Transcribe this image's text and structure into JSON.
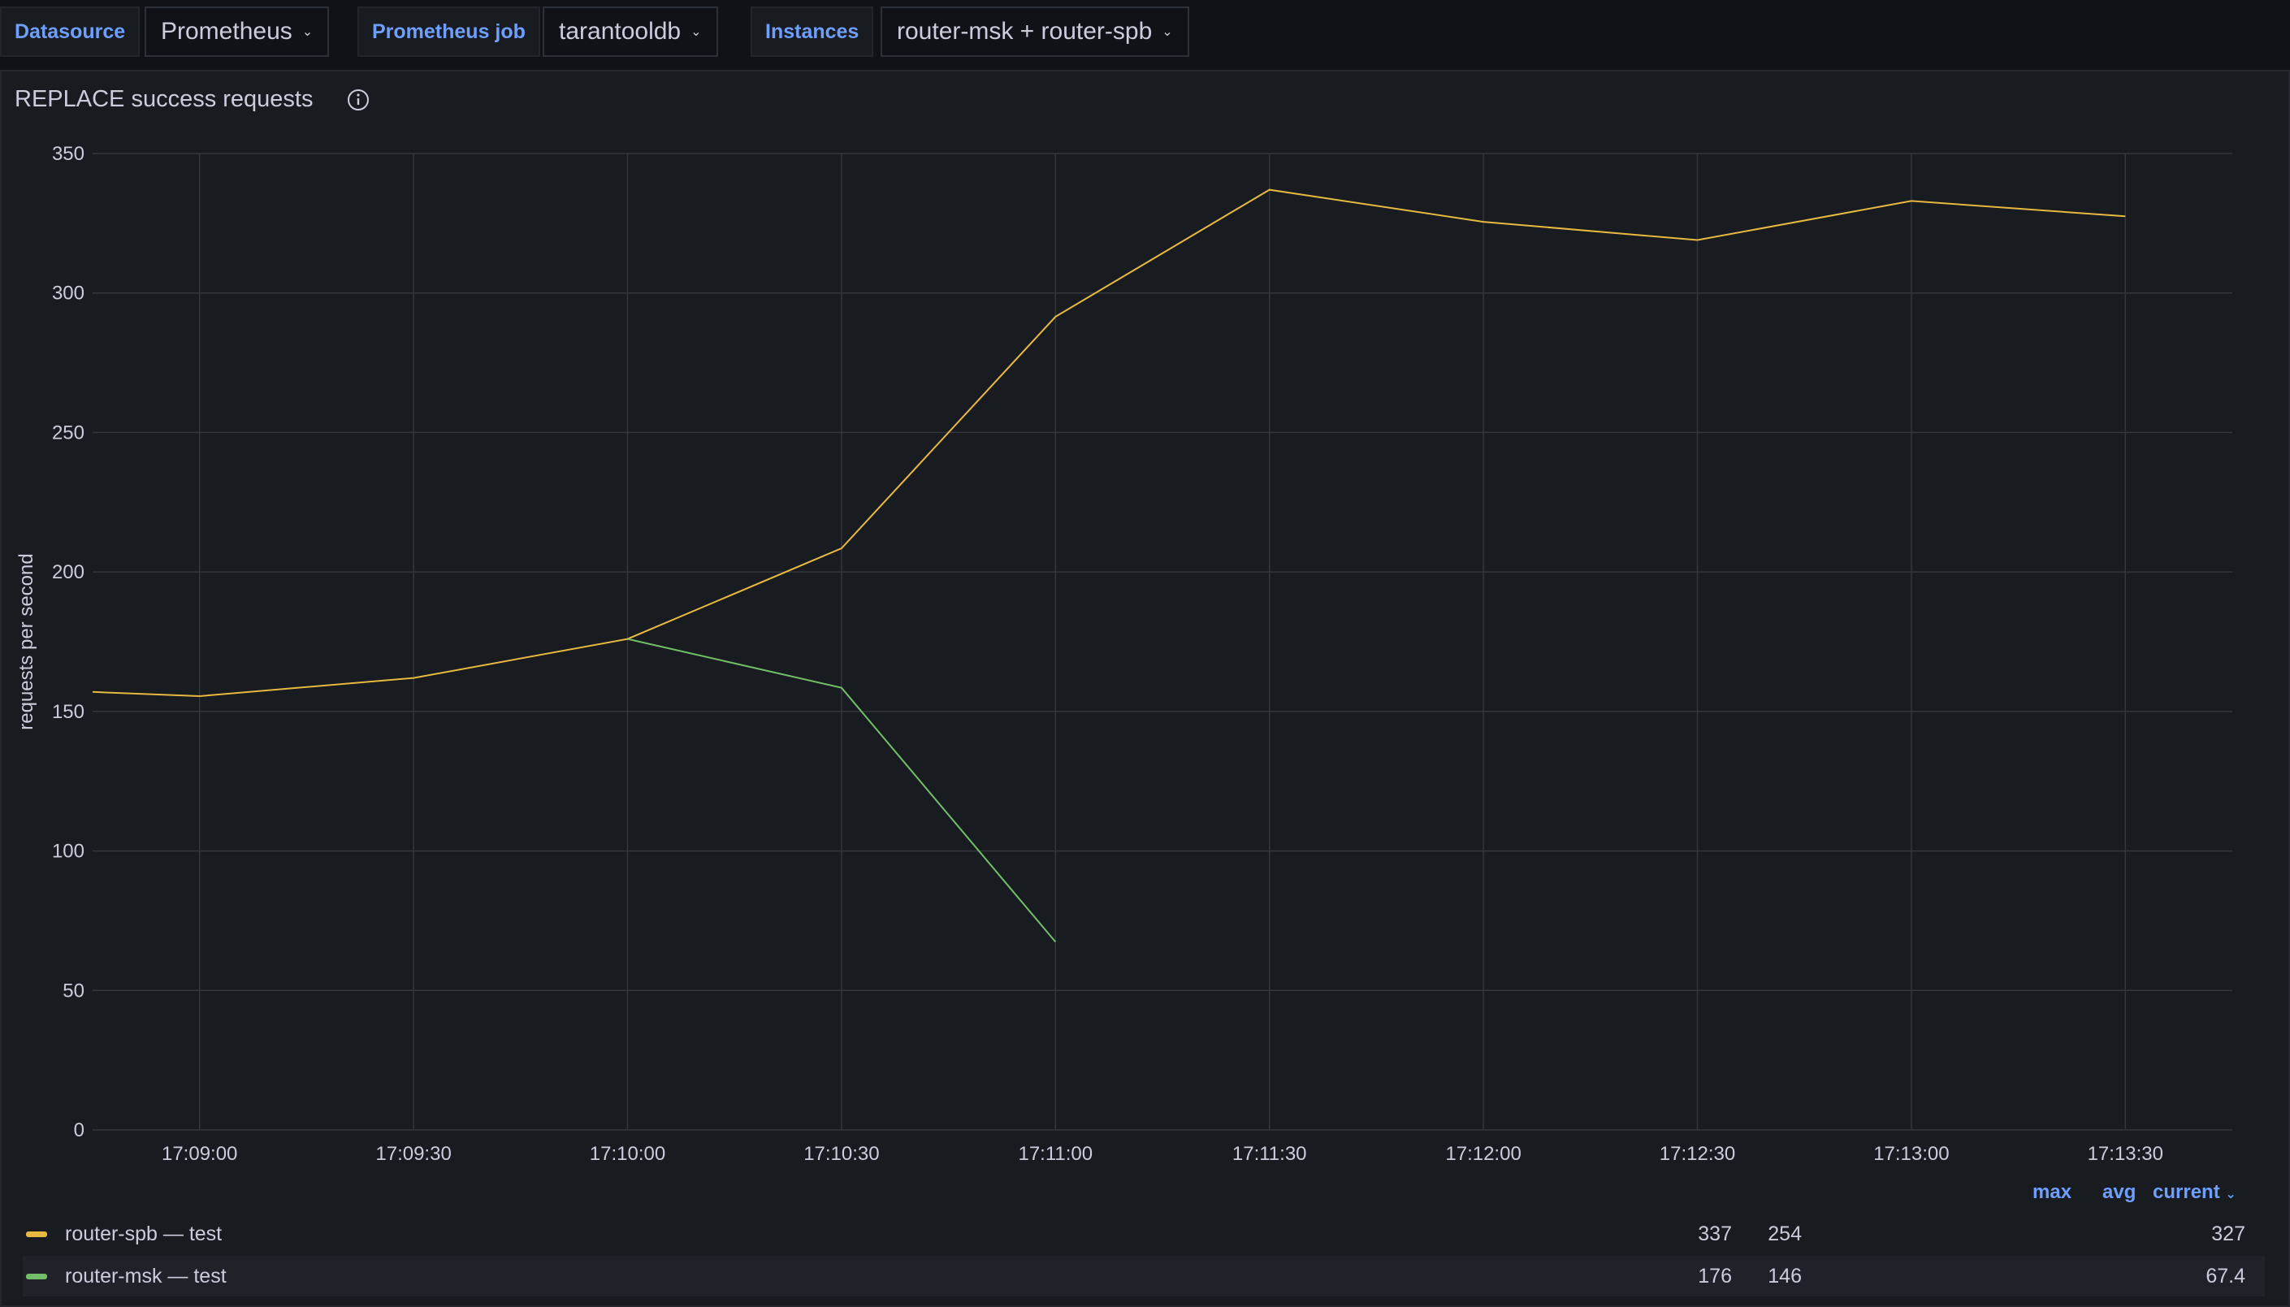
{
  "variables": {
    "datasource": {
      "label": "Datasource",
      "value": "Prometheus"
    },
    "job": {
      "label": "Prometheus job",
      "value": "tarantooldb"
    },
    "instances": {
      "label": "Instances",
      "value": "router-msk + router-spb"
    }
  },
  "panel": {
    "title": "REPLACE success requests"
  },
  "legend": {
    "headers": {
      "max": "max",
      "avg": "avg",
      "current": "current"
    },
    "rows": [
      {
        "name": "router-spb — test",
        "max": "337",
        "avg": "254",
        "current": "327"
      },
      {
        "name": "router-msk — test",
        "max": "176",
        "avg": "146",
        "current": "67.4"
      }
    ]
  },
  "colors": {
    "router-spb": "#e8b940",
    "router-msk": "#73bf69",
    "accent": "#6e9fff"
  },
  "icons": {
    "info": "info-circle-icon",
    "chevron": "chevron-down-icon"
  },
  "chart_data": {
    "type": "line",
    "title": "REPLACE success requests",
    "ylabel": "requests per second",
    "xlabel": "",
    "ylim": [
      0,
      350
    ],
    "yticks": [
      0,
      50,
      100,
      150,
      200,
      250,
      300,
      350
    ],
    "xticks": [
      "17:09:00",
      "17:09:30",
      "17:10:00",
      "17:10:30",
      "17:11:00",
      "17:11:30",
      "17:12:00",
      "17:12:30",
      "17:13:00",
      "17:13:30"
    ],
    "x": [
      "17:08:45",
      "17:09:00",
      "17:09:30",
      "17:10:00",
      "17:10:30",
      "17:11:00",
      "17:11:30",
      "17:12:00",
      "17:12:30",
      "17:13:00",
      "17:13:30"
    ],
    "series": [
      {
        "name": "router-spb — test",
        "values": [
          157,
          155.5,
          162,
          176,
          208.5,
          291.5,
          337,
          325.5,
          319,
          333,
          327.5
        ]
      },
      {
        "name": "router-msk — test",
        "values": [
          null,
          null,
          null,
          176,
          158.5,
          67.4,
          null,
          null,
          null,
          null,
          null
        ]
      }
    ],
    "grid": true,
    "legend": "bottom"
  }
}
